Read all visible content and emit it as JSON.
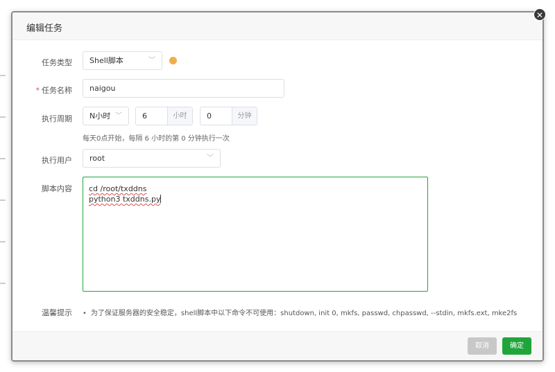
{
  "dialog": {
    "title": "编辑任务",
    "close_icon": "✕"
  },
  "form": {
    "task_type": {
      "label": "任务类型",
      "value": "Shell脚本"
    },
    "task_name": {
      "label": "任务名称",
      "required_mark": "*",
      "value": "naigou"
    },
    "period": {
      "label": "执行周期",
      "mode": "N小时",
      "hours": "6",
      "hours_unit": "小时",
      "minutes": "0",
      "minutes_unit": "分钟",
      "hint": "每天0点开始，每隔 6 小时的第 0 分钟执行一次"
    },
    "user": {
      "label": "执行用户",
      "value": "root"
    },
    "script": {
      "label": "脚本内容",
      "lines": [
        "cd /root/txddns",
        "python3 txddns.py"
      ]
    },
    "tip": {
      "label": "温馨提示",
      "text": "为了保证服务器的安全稳定，shell脚本中以下命令不可使用：shutdown, init 0, mkfs, passwd, chpasswd, --stdin, mkfs.ext, mke2fs"
    }
  },
  "footer": {
    "cancel_label": "取消",
    "confirm_label": "确定"
  },
  "colors": {
    "accent": "#20a53a",
    "status_dot": "#f0ad4e",
    "required": "#e24c4c"
  }
}
